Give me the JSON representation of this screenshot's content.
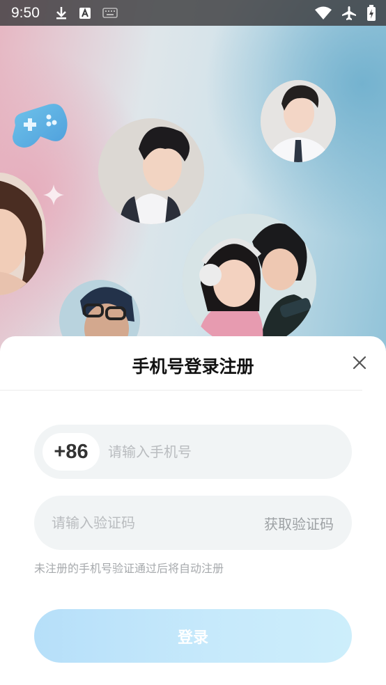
{
  "status_bar": {
    "time": "9:50",
    "icons": [
      "download-icon",
      "a-notification-icon",
      "keyboard-icon",
      "wifi-icon",
      "airplane-icon",
      "battery-icon"
    ]
  },
  "decor": {
    "icons": [
      "gamepad-icon",
      "sparkle-icon"
    ]
  },
  "login_sheet": {
    "title": "手机号登录注册",
    "close_icon": "close-icon",
    "country_code": "+86",
    "phone_placeholder": "请输入手机号",
    "code_placeholder": "请输入验证码",
    "get_code_label": "获取验证码",
    "hint": "未注册的手机号验证通过后将自动注册",
    "login_label": "登录"
  },
  "colors": {
    "field_bg": "#f1f4f5",
    "login_gradient_start": "#b6dff9",
    "login_gradient_end": "#cdeefb",
    "placeholder": "#b9bcbf"
  }
}
